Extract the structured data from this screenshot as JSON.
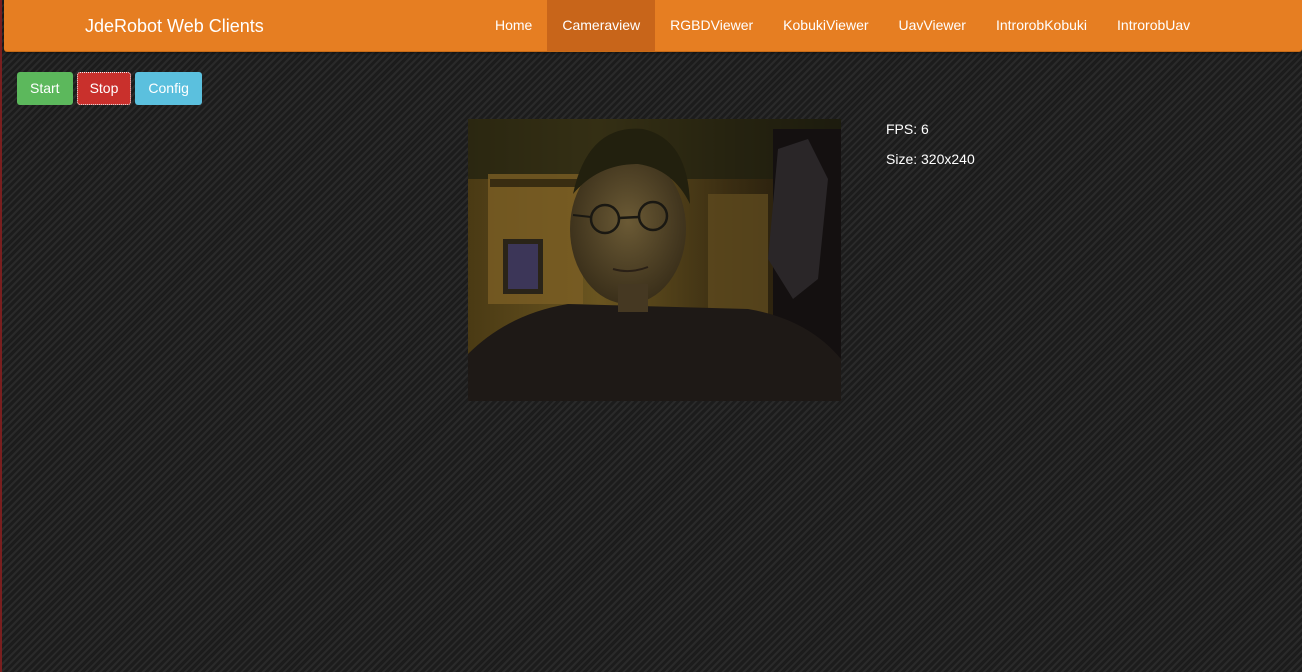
{
  "navbar": {
    "brand": "JdeRobot Web Clients",
    "items": [
      {
        "label": "Home",
        "active": false
      },
      {
        "label": "Cameraview",
        "active": true
      },
      {
        "label": "RGBDViewer",
        "active": false
      },
      {
        "label": "KobukiViewer",
        "active": false
      },
      {
        "label": "UavViewer",
        "active": false
      },
      {
        "label": "IntrorobKobuki",
        "active": false
      },
      {
        "label": "IntrorobUav",
        "active": false
      }
    ],
    "color": "#e67e22",
    "active_color": "#c8651a"
  },
  "toolbar": {
    "start_label": "Start",
    "stop_label": "Stop",
    "config_label": "Config"
  },
  "stats": {
    "fps": "FPS: 6",
    "size": "Size: 320x240"
  },
  "colors": {
    "start": "#5cb85c",
    "stop": "#c9302c",
    "config": "#5bc0de"
  }
}
